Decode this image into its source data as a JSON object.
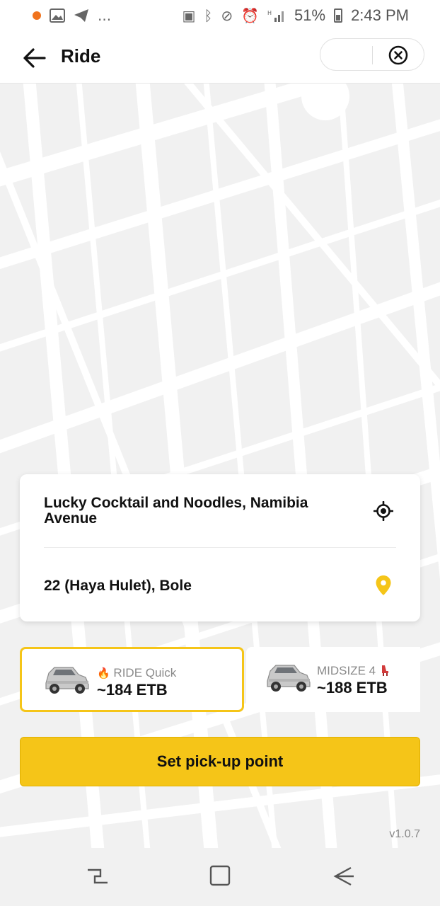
{
  "status_bar": {
    "icons_left": [
      "notification-dot",
      "image-icon",
      "telegram-icon",
      "more-dots"
    ],
    "more": "...",
    "icons_right": [
      "battery-saver-icon",
      "bluetooth-icon",
      "vibrate-off-icon",
      "alarm-icon",
      "hd-icon",
      "signal-icon"
    ],
    "battery_percent": "51%",
    "time": "2:43 PM"
  },
  "app_bar": {
    "title": "Ride",
    "back_icon": "arrow-left-icon",
    "close_icon": "close-circle-icon"
  },
  "route": {
    "pickup": "Lucky Cocktail and Noodles, Namibia Avenue",
    "dropoff": "22 (Haya Hulet), Bole",
    "pickup_icon": "crosshair-icon",
    "dropoff_icon": "map-pin-icon"
  },
  "ride_options": [
    {
      "label": "RIDE Quick",
      "badge_icon": "fire-icon",
      "price": "~184 ETB",
      "selected": true
    },
    {
      "label": "MIDSIZE 4",
      "badge_icon": "seat-icon",
      "price": "~188 ETB",
      "selected": false
    }
  ],
  "cta_label": "Set pick-up point",
  "version": "v1.0.7",
  "colors": {
    "accent": "#f5c518",
    "map_bg": "#f1f1f1",
    "road": "#ffffff"
  }
}
